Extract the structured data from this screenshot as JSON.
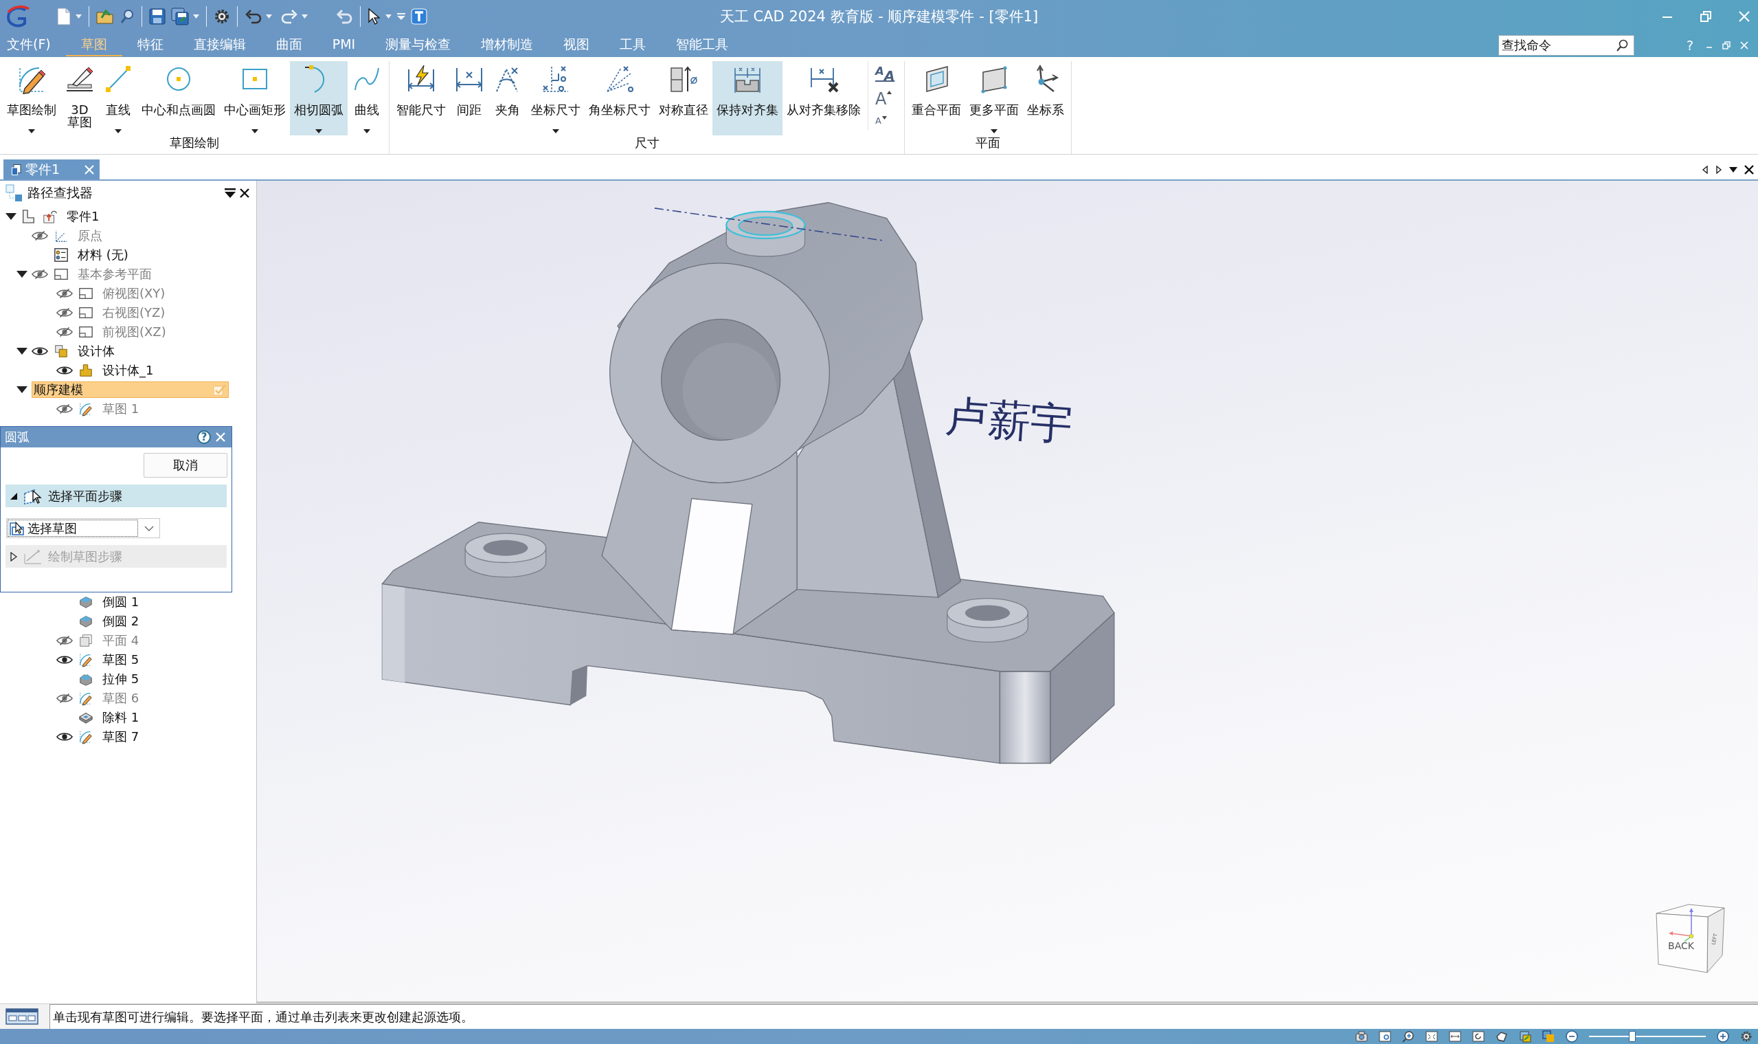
{
  "title_bar": {
    "title": "天工 CAD 2024 教育版 - 顺序建模零件 - [零件1]"
  },
  "menu_bar": {
    "items": [
      {
        "label": "文件(F)",
        "selected": false
      },
      {
        "label": "草图",
        "selected": true
      },
      {
        "label": "特征",
        "selected": false
      },
      {
        "label": "直接编辑",
        "selected": false
      },
      {
        "label": "曲面",
        "selected": false
      },
      {
        "label": "PMI",
        "selected": false
      },
      {
        "label": "测量与检查",
        "selected": false
      },
      {
        "label": "增材制造",
        "selected": false
      },
      {
        "label": "视图",
        "selected": false
      },
      {
        "label": "工具",
        "selected": false
      },
      {
        "label": "智能工具",
        "selected": false
      }
    ],
    "search": {
      "placeholder": "查找命令"
    },
    "help": "?"
  },
  "ribbon": {
    "groups": [
      {
        "label": "草图绘制",
        "buttons": [
          {
            "label": "草图绘制",
            "has_menu": true,
            "selected": false
          },
          {
            "label": "3D\n草图",
            "has_menu": false,
            "selected": false
          },
          {
            "label": "直线",
            "has_menu": true,
            "selected": false
          },
          {
            "label": "中心和点画圆",
            "has_menu": false,
            "selected": false
          },
          {
            "label": "中心画矩形",
            "has_menu": true,
            "selected": false
          },
          {
            "label": "相切圆弧",
            "has_menu": true,
            "selected": true
          },
          {
            "label": "曲线",
            "has_menu": true,
            "selected": false
          }
        ]
      },
      {
        "label": "尺寸",
        "buttons": [
          {
            "label": "智能尺寸",
            "has_menu": false,
            "selected": false
          },
          {
            "label": "间距",
            "has_menu": false,
            "selected": false
          },
          {
            "label": "夹角",
            "has_menu": false,
            "selected": false
          },
          {
            "label": "坐标尺寸",
            "has_menu": true,
            "selected": false
          },
          {
            "label": "角坐标尺寸",
            "has_menu": false,
            "selected": false
          },
          {
            "label": "对称直径",
            "has_menu": false,
            "selected": false
          },
          {
            "label": "保持对齐集",
            "has_menu": false,
            "selected": true
          },
          {
            "label": "从对齐集移除",
            "has_menu": false,
            "selected": false
          }
        ],
        "text_tools": [
          {
            "kind": "style",
            "glyph": "$^{A}$A"
          },
          {
            "kind": "grow",
            "glyph": "A"
          },
          {
            "kind": "shrink",
            "glyph": "A"
          }
        ]
      },
      {
        "label": "平面",
        "buttons": [
          {
            "label": "重合平面",
            "has_menu": false,
            "selected": false
          },
          {
            "label": "更多平面",
            "has_menu": true,
            "selected": false
          },
          {
            "label": "坐标系",
            "has_menu": false,
            "selected": false
          }
        ]
      }
    ]
  },
  "document_tabs": [
    {
      "label": "零件1",
      "selected": true
    }
  ],
  "pathfinder": {
    "title": "路径查找器",
    "tree": [
      {
        "label": "零件1",
        "kind": "part",
        "selected": false,
        "expanded": true,
        "children": [
          {
            "label": "原点",
            "kind": "origin",
            "visible": false,
            "selected": false
          },
          {
            "label": "材料 (无)",
            "kind": "material",
            "selected": false
          },
          {
            "label": "基本参考平面",
            "kind": "plane",
            "visible": false,
            "selected": false,
            "expanded": true,
            "children": [
              {
                "label": "俯视图(XY)",
                "kind": "plane",
                "visible": false,
                "selected": false
              },
              {
                "label": "右视图(YZ)",
                "kind": "plane",
                "visible": false,
                "selected": false
              },
              {
                "label": "前视图(XZ)",
                "kind": "plane",
                "visible": false,
                "selected": false
              }
            ]
          },
          {
            "label": "设计体",
            "kind": "body_group",
            "visible": true,
            "selected": false,
            "expanded": true,
            "children": [
              {
                "label": "设计体_1",
                "kind": "body",
                "visible": true,
                "selected": false
              }
            ]
          },
          {
            "label": "顺序建模",
            "kind": "modeling",
            "selected": true,
            "expanded": true,
            "children": [
              {
                "label": "草图 1",
                "kind": "sketch",
                "visible": false,
                "selected": false
              }
            ]
          }
        ]
      }
    ]
  },
  "arc_dialog": {
    "title": "圆弧",
    "help": "?",
    "cancel_button": "取消",
    "steps": [
      {
        "label": "选择平面步骤",
        "selected": true,
        "expanded": true,
        "disabled": false,
        "dropdown": {
          "value": "选择草图"
        }
      },
      {
        "label": "绘制草图步骤",
        "selected": false,
        "expanded": false,
        "disabled": true
      }
    ]
  },
  "pathfinder_continued": {
    "tree": [
      {
        "label": "倒圆 1",
        "kind": "fillet",
        "selected": false
      },
      {
        "label": "倒圆 2",
        "kind": "fillet",
        "selected": false
      },
      {
        "label": "平面 4",
        "kind": "plane_feature",
        "visible": false,
        "selected": false
      },
      {
        "label": "草图 5",
        "kind": "sketch",
        "visible": true,
        "selected": false
      },
      {
        "label": "拉伸 5",
        "kind": "extrude",
        "selected": false
      },
      {
        "label": "草图 6",
        "kind": "sketch",
        "visible": false,
        "selected": false
      },
      {
        "label": "除料 1",
        "kind": "cut",
        "selected": false
      },
      {
        "label": "草图 7",
        "kind": "sketch",
        "visible": true,
        "selected": false
      }
    ]
  },
  "viewport": {
    "sketch_text": "卢薪宇",
    "view_cube": {
      "front_label": "BACK",
      "side_label": "LEFT"
    }
  },
  "status_bar": {
    "message": "单击现有草图可进行编辑。要选择平面，通过单击列表来更改创建起源选项。"
  },
  "view_toolbar": {
    "zoom_slider": {
      "level": 0.37
    }
  }
}
